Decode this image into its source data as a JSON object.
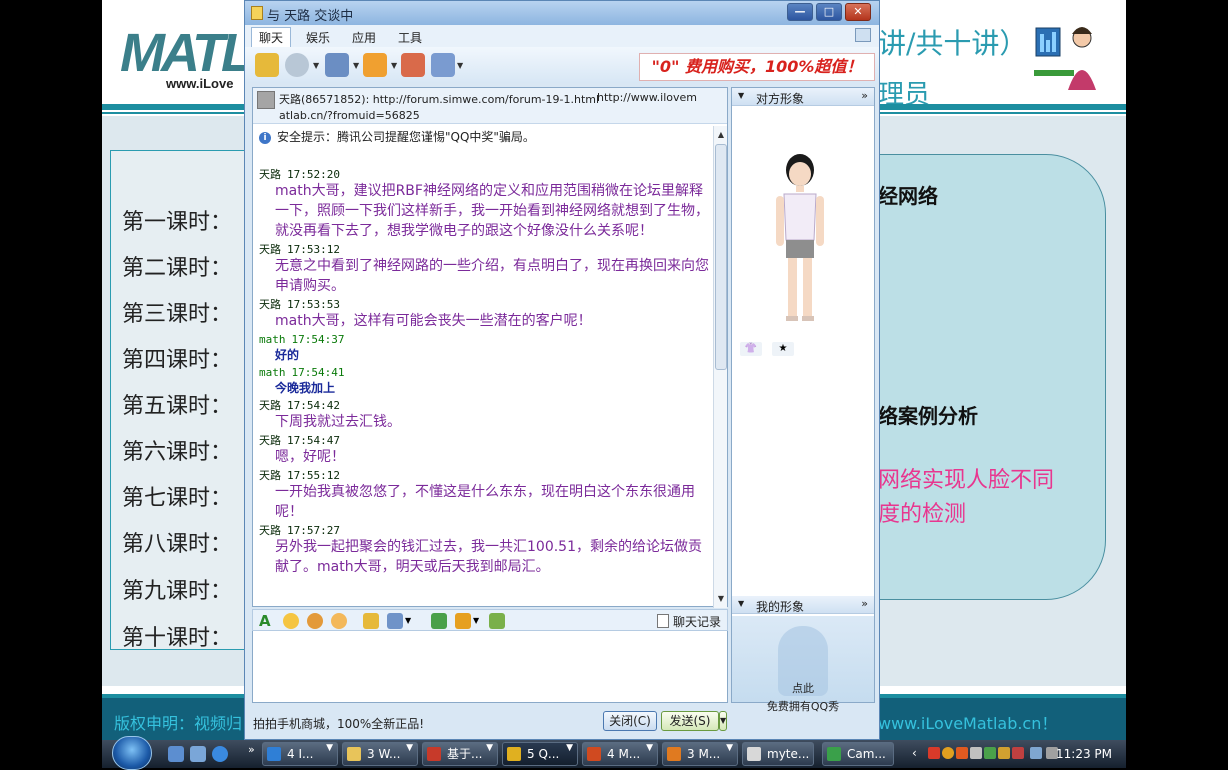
{
  "slide": {
    "logo": "MATL",
    "logo_url": "www.iLove",
    "title_right": "讲/共十讲）",
    "title_right2": "理员",
    "lessons": [
      "第一课时：",
      "第二课时：",
      "第三课时：",
      "第四课时：",
      "第五课时：",
      "第六课时：",
      "第七课时：",
      "第八课时：",
      "第九课时：",
      "第十课时："
    ],
    "right_text1": "经网络",
    "right_text2": "络案例分析",
    "right_text3": "网络实现人脸不同",
    "right_text4": "度的检测",
    "footer_left": "版权申明：视频归",
    "footer_right": "www.iLoveMatlab.cn！"
  },
  "window": {
    "title": "与 天路 交谈中",
    "min": "—",
    "max": "□",
    "close": "✕"
  },
  "menu": {
    "items": [
      "聊天",
      "娱乐",
      "应用",
      "工具"
    ]
  },
  "ad": {
    "text": "\"0\" 费用购买，100%超值！"
  },
  "chat_header": {
    "line1": "天路(86571852): http://forum.simwe.com/forum-19-1.html",
    "url2": "http://www.ilovem",
    "line2": "atlab.cn/?fromuid=56825"
  },
  "security": {
    "text": "安全提示：腾讯公司提醒您谨惕\"QQ中奖\"骗局。"
  },
  "messages": [
    {
      "sender": "天路",
      "time": "17:52:20",
      "text": "math大哥，建议把RBF神经网络的定义和应用范围稍微在论坛里解释一下，照顾一下我们这样新手，我一开始看到神经网络就想到了生物，就没再看下去了，想我学微电子的跟这个好像没什么关系呢！",
      "me": false
    },
    {
      "sender": "天路",
      "time": "17:53:12",
      "text": "无意之中看到了神经网路的一些介绍，有点明白了，现在再换回来向您申请购买。",
      "me": false
    },
    {
      "sender": "天路",
      "time": "17:53:53",
      "text": "math大哥，这样有可能会丧失一些潜在的客户呢！",
      "me": false
    },
    {
      "sender": "math",
      "time": "17:54:37",
      "text": "好的",
      "me": true
    },
    {
      "sender": "math",
      "time": "17:54:41",
      "text": "今晚我加上",
      "me": true
    },
    {
      "sender": "天路",
      "time": "17:54:42",
      "text": "下周我就过去汇钱。",
      "me": false
    },
    {
      "sender": "天路",
      "time": "17:54:47",
      "text": "嗯，好呢！",
      "me": false
    },
    {
      "sender": "天路",
      "time": "17:55:12",
      "text": "一开始我真被忽悠了，不懂这是什么东东，现在明白这个东东很通用呢！",
      "me": false
    },
    {
      "sender": "天路",
      "time": "17:57:27",
      "text": "另外我一起把聚会的钱汇过去，我一共汇100.51，剩余的给论坛做贡献了。math大哥，明天或后天我到邮局汇。",
      "me": false
    }
  ],
  "input_bar": {
    "history_label": "聊天记录"
  },
  "bottom": {
    "promo": "拍拍手机商城，100%全新正品!",
    "close_label": "关闭(C)",
    "send_label": "发送(S)"
  },
  "side": {
    "peer_label": "对方形象",
    "my_label": "我的形象",
    "more": "»",
    "my_hint1": "点此",
    "my_hint2": "免费拥有QQ秀"
  },
  "taskbar": {
    "items": [
      {
        "label": "4 I...",
        "color": "#2f7fd6"
      },
      {
        "label": "3 W...",
        "color": "#e8c45a"
      },
      {
        "label": "基于...",
        "color": "#c73a2a"
      },
      {
        "label": "5 Q...",
        "color": "#e0b020"
      },
      {
        "label": "4 M...",
        "color": "#d04a20"
      },
      {
        "label": "3 M...",
        "color": "#e07a20"
      },
      {
        "label": "myte...",
        "color": "#d8d8d8"
      },
      {
        "label": "Cam...",
        "color": "#3aa04a"
      }
    ],
    "clock": "11:23 PM"
  }
}
